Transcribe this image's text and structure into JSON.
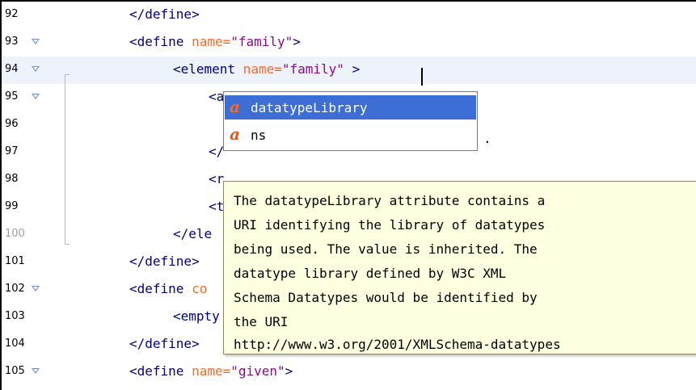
{
  "lines": [
    {
      "num": "92",
      "code": "</define>"
    },
    {
      "num": "93",
      "code": "<define name=\"family\">"
    },
    {
      "num": "94",
      "code": "<element name=\"family\" >"
    },
    {
      "num": "95",
      "code": "<a"
    },
    {
      "num": "96",
      "code": ""
    },
    {
      "num": "97",
      "code": "</"
    },
    {
      "num": "98",
      "code": "<r"
    },
    {
      "num": "99",
      "code": "<t"
    },
    {
      "num": "100",
      "code": "</ele"
    },
    {
      "num": "101",
      "code": "</define>"
    },
    {
      "num": "102",
      "code": "<define co"
    },
    {
      "num": "103",
      "code": "<empty"
    },
    {
      "num": "104",
      "code": "</define>"
    },
    {
      "num": "105",
      "code": "<define name=\"given\">"
    }
  ],
  "tokens": {
    "l93": {
      "tag": "<define ",
      "attr": "name=",
      "val": "\"family\"",
      "close": ">"
    },
    "l94": {
      "tag": "<element ",
      "attr": "name=",
      "val": "\"family\"",
      "close": " >"
    },
    "l102": {
      "tag": "<define ",
      "attr": "co"
    },
    "l105": {
      "tag": "<define ",
      "attr": "name=",
      "val": "\"given\"",
      "close": ">"
    }
  },
  "completion": {
    "items": [
      {
        "label": "datatypeLibrary",
        "icon": "attribute-icon",
        "selected": true
      },
      {
        "label": "ns",
        "icon": "attribute-icon",
        "selected": false
      }
    ],
    "icon_glyph": "a"
  },
  "trailing_dot": ".",
  "tooltip": {
    "lines": [
      "The datatypeLibrary attribute contains a",
      "URI identifying the library of datatypes",
      "being used. The value is inherited. The",
      "datatype library defined by W3C XML",
      "Schema Datatypes would be identified by",
      "the URI",
      "http://www.w3.org/2001/XMLSchema-datatypes"
    ]
  },
  "colors": {
    "tag": "#000080",
    "attribute": "#f26b2a",
    "value": "#8a0a8a",
    "selection": "#3d6ed6",
    "tooltip_bg": "#ffffe1"
  }
}
